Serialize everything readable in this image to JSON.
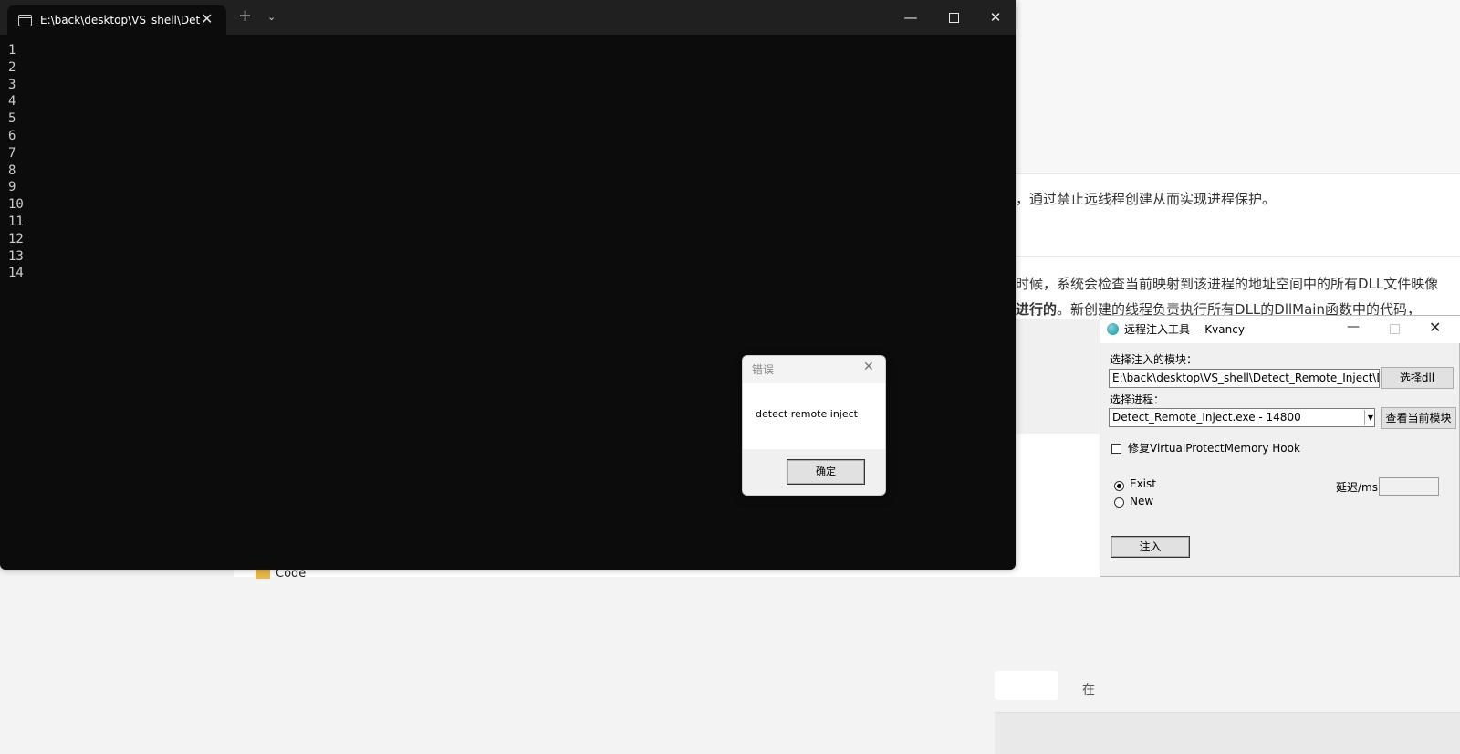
{
  "terminal": {
    "tab_title": "E:\\back\\desktop\\VS_shell\\Det",
    "close_glyph": "✕",
    "newtab_glyph": "+",
    "dropdown_glyph": "⌄",
    "minimize_glyph": "—",
    "close_window_glyph": "✕",
    "lines": [
      "1",
      "2",
      "3",
      "4",
      "5",
      "6",
      "7",
      "8",
      "9",
      "10",
      "11",
      "12",
      "13",
      "14"
    ]
  },
  "error_dialog": {
    "title": "错误",
    "message": "detect remote inject",
    "ok_label": "确定",
    "close_glyph": "✕"
  },
  "inject_tool": {
    "title": "远程注入工具 -- Kvancy",
    "minimize_glyph": "—",
    "close_glyph": "✕",
    "module_label": "选择注入的模块：",
    "dll_path": "E:\\back\\desktop\\VS_shell\\Detect_Remote_Inject\\D",
    "select_dll_label": "选择dll",
    "process_label": "选择进程：",
    "process_value": "Detect_Remote_Inject.exe - 14800",
    "combo_arrow": "▼",
    "view_modules_label": "查看当前模块",
    "fix_hook_label": "修复VirtualProtectMemory Hook",
    "fix_hook_checked": false,
    "radio_exist_label": "Exist",
    "radio_new_label": "New",
    "selected_mode": "Exist",
    "delay_label": "延迟/ms",
    "delay_value": "",
    "inject_label": "注入"
  },
  "background_article": {
    "line1": "案，通过禁止远线程创建从而实现进程保护。",
    "line2": "的时候，系统会检查当前映射到该进程的地址空间中的所有DLL文件映像",
    "line3_bold": "中进行的",
    "line3_rest": "。新创建的线程负责执行所有DLL的DllMain函数中的代码，",
    "search_hint": "在",
    "explorer_item": "Code"
  }
}
